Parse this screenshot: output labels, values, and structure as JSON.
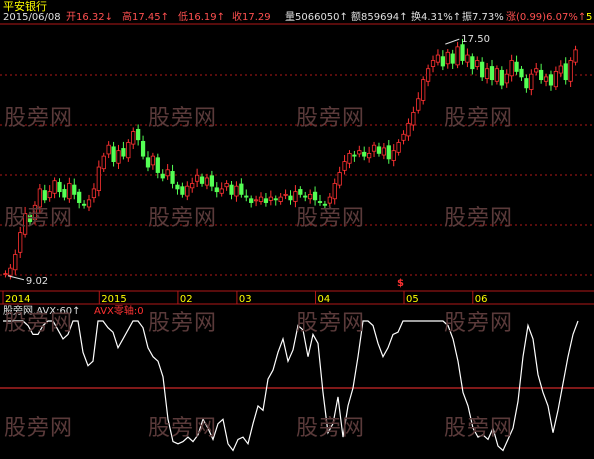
{
  "stock_name": "平安银行",
  "header": {
    "date": "2015/06/08",
    "open_label": "开",
    "open_value": "16.32",
    "open_arrow": "↓",
    "high_label": "高",
    "high_value": "17.45",
    "high_arrow": "↑",
    "low_label": "低",
    "low_value": "16.19",
    "low_arrow": "↑",
    "close_label": "收",
    "close_value": "17.29",
    "volume_label": "量",
    "volume_value": "5066050",
    "volume_arrow": "↑",
    "amount_label": "额",
    "amount_value": "859694",
    "amount_arrow": "↑",
    "turnover_label": "换",
    "turnover_value": "4.31%",
    "turnover_arrow": "↑",
    "amplitude_label": "振",
    "amplitude_value": "7.73%",
    "change_label": "涨",
    "change_value": "(0.99)6.07%",
    "change_arrow": "↑",
    "trailing": "5"
  },
  "watermark": "股旁网",
  "marker_symbol": "$",
  "indicator": {
    "name": "股旁网.AVX:60",
    "arrow": "↑",
    "zero_label": "AVX零轴:0"
  },
  "colors": {
    "background": "#000000",
    "up": "#ff3232",
    "down": "#54ff54",
    "grid": "#b01818",
    "text_white": "#e0e0e0",
    "label_yellow": "#ffff00",
    "header_red": "#ff5050",
    "line_white": "#ffffff"
  },
  "chart_data": [
    {
      "type": "candlestick",
      "x_tick_labels": [
        "2014",
        "2015",
        "02",
        "03",
        "04",
        "05",
        "06"
      ],
      "ylim": [
        8.5,
        18.2
      ],
      "annotations": [
        {
          "label": "17.50",
          "kind": "high",
          "value": 17.5
        },
        {
          "label": "9.02",
          "kind": "low",
          "value": 9.02
        }
      ],
      "close_series": [
        9.1,
        9.3,
        9.8,
        10.6,
        11.3,
        11.0,
        11.6,
        12.2,
        11.8,
        12.1,
        12.5,
        12.1,
        11.9,
        12.4,
        12.0,
        11.7,
        11.6,
        11.8,
        12.2,
        13.0,
        13.4,
        13.8,
        13.2,
        13.6,
        13.4,
        13.9,
        14.3,
        14.0,
        13.4,
        13.0,
        13.4,
        12.8,
        12.6,
        12.9,
        12.4,
        12.2,
        12.0,
        12.3,
        12.4,
        12.7,
        12.4,
        12.6,
        12.3,
        12.1,
        12.2,
        12.4,
        12.0,
        12.3,
        12.0,
        11.9,
        11.7,
        11.8,
        11.9,
        11.7,
        11.9,
        11.8,
        11.9,
        12.0,
        11.8,
        12.1,
        12.0,
        11.9,
        12.0,
        11.8,
        11.7,
        11.6,
        11.9,
        12.4,
        12.8,
        13.2,
        13.5,
        13.4,
        13.6,
        13.4,
        13.5,
        13.8,
        13.5,
        13.7,
        13.3,
        13.6,
        13.9,
        14.2,
        14.6,
        15.0,
        15.5,
        16.2,
        16.6,
        16.9,
        17.1,
        16.7,
        17.2,
        16.8,
        17.4,
        16.9,
        17.1,
        16.6,
        16.9,
        16.3,
        16.6,
        16.2,
        16.6,
        16.0,
        16.4,
        16.9,
        16.5,
        16.3,
        15.9,
        16.4,
        16.6,
        16.2,
        16.3,
        16.0,
        16.5,
        16.7,
        16.2,
        16.9,
        17.29
      ]
    },
    {
      "type": "line",
      "series": [
        {
          "name": "AVX",
          "values": [
            60,
            60,
            60,
            60,
            60,
            58,
            54,
            54,
            58,
            60,
            60,
            56,
            52,
            54,
            60,
            60,
            46,
            40,
            42,
            60,
            60,
            57,
            55,
            48,
            52,
            56,
            60,
            60,
            57,
            48,
            44,
            42,
            35,
            16,
            6,
            5,
            6,
            8,
            6,
            9,
            16,
            12,
            7,
            14,
            16,
            5,
            2,
            7,
            8,
            5,
            14,
            22,
            20,
            34,
            38,
            46,
            52,
            42,
            47,
            58,
            56,
            44,
            54,
            50,
            28,
            10,
            14,
            26,
            8,
            22,
            30,
            44,
            60,
            60,
            58,
            50,
            44,
            48,
            54,
            55,
            60,
            60,
            60,
            60,
            60,
            60,
            60,
            60,
            60,
            58,
            52,
            42,
            28,
            22,
            12,
            8,
            9,
            7,
            12,
            4,
            2,
            7,
            12,
            24,
            44,
            58,
            52,
            36,
            28,
            22,
            10,
            20,
            32,
            44,
            54,
            60
          ]
        }
      ],
      "ylim": [
        0,
        60
      ],
      "zero_line": 30
    }
  ]
}
